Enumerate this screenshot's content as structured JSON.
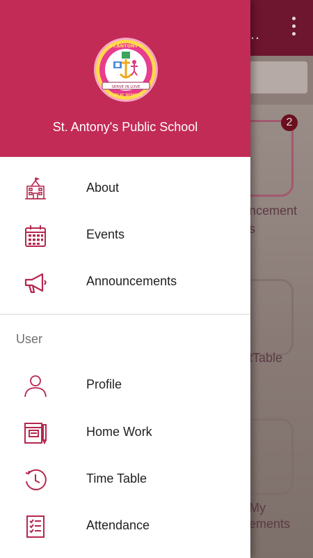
{
  "app": {
    "school_name": "St. Antony's Public School"
  },
  "drawer": {
    "logo_text": [
      "ST.ANTONY'S",
      "PUBLIC SCHOOL",
      "SERVE IN LOVE"
    ],
    "primary_items": [
      {
        "label": "About",
        "icon": "school-building-icon"
      },
      {
        "label": "Events",
        "icon": "calendar-icon"
      },
      {
        "label": "Announcements",
        "icon": "megaphone-icon"
      }
    ],
    "section_label": "User",
    "user_items": [
      {
        "label": "Profile",
        "icon": "user-icon"
      },
      {
        "label": "Home Work",
        "icon": "homework-book-icon"
      },
      {
        "label": "Time Table",
        "icon": "clock-icon"
      },
      {
        "label": "Attendance",
        "icon": "checklist-icon"
      }
    ]
  },
  "background": {
    "badge_count": "2",
    "labels": [
      "ncement",
      "s",
      "tTable",
      "My",
      "ements"
    ]
  },
  "colors": {
    "header": "#c22b56",
    "icon": "#b5274e",
    "appbar": "#6e1530"
  }
}
